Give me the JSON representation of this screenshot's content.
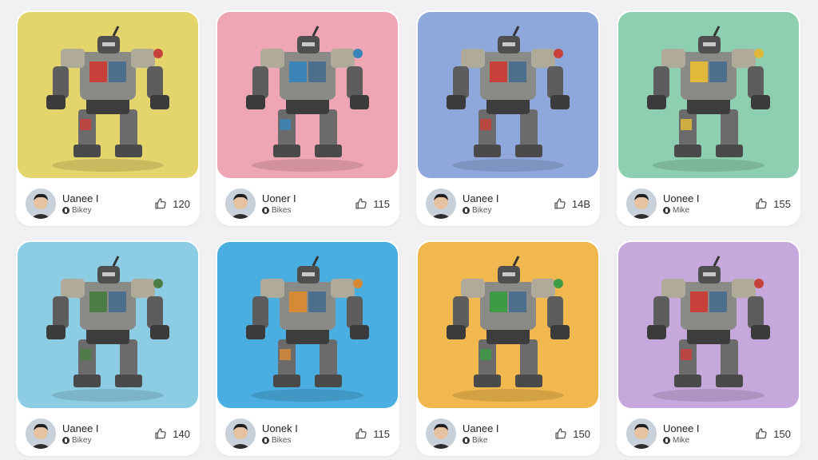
{
  "cards": [
    {
      "author": "Uanee I",
      "tag": "Bikey",
      "likes": "120",
      "bg": "#e4d46c",
      "accent": "#c8403a"
    },
    {
      "author": "Uoner I",
      "tag": "Bikes",
      "likes": "115",
      "bg": "#eea6b4",
      "accent": "#3a84b8"
    },
    {
      "author": "Uanee I",
      "tag": "Bikey",
      "likes": "14B",
      "bg": "#8fa8db",
      "accent": "#c8403a"
    },
    {
      "author": "Uonee I",
      "tag": "Mike",
      "likes": "155",
      "bg": "#8dcfb0",
      "accent": "#e0b93a"
    },
    {
      "author": "Uanee I",
      "tag": "Bikey",
      "likes": "140",
      "bg": "#8dcde4",
      "accent": "#4c7d44"
    },
    {
      "author": "Uonek I",
      "tag": "Bikes",
      "likes": "115",
      "bg": "#4aaee0",
      "accent": "#d68a36"
    },
    {
      "author": "Uanee I",
      "tag": "Bike",
      "likes": "150",
      "bg": "#f0b84e",
      "accent": "#3f9a46"
    },
    {
      "author": "Uonee I",
      "tag": "Mike",
      "likes": "150",
      "bg": "#c7a8dc",
      "accent": "#c8403a"
    }
  ],
  "icons": {
    "like": "thumbs-up-icon",
    "tag": "bike-icon"
  }
}
